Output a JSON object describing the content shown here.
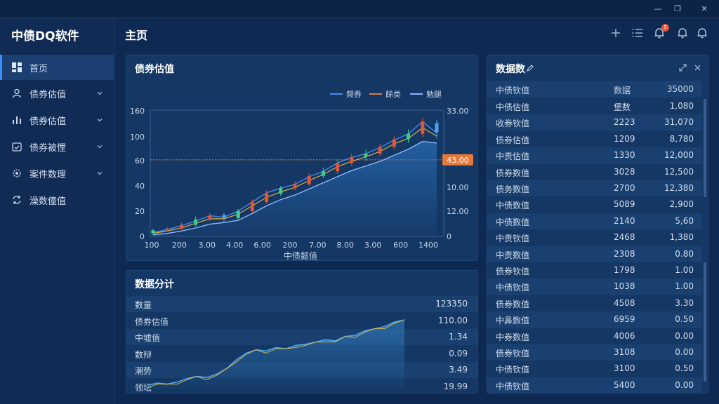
{
  "window": {
    "minimize": "—",
    "restore": "❐",
    "close": "✕"
  },
  "sidebar": {
    "brand": "中债DQ软件",
    "items": [
      {
        "label": "首页",
        "icon": "dashboard-icon",
        "active": true
      },
      {
        "label": "债券估值",
        "icon": "user-icon",
        "chevron": true
      },
      {
        "label": "债券估值",
        "icon": "bar-chart-icon",
        "chevron": true
      },
      {
        "label": "债券被悝",
        "icon": "calendar-icon",
        "chevron": true
      },
      {
        "label": "案件数理",
        "icon": "gear-icon",
        "chevron": true
      },
      {
        "label": "澡数僮值",
        "icon": "sync-icon",
        "chevron": false
      }
    ]
  },
  "header": {
    "title": "主页",
    "notification_count": "5"
  },
  "valuation_chart": {
    "title": "债券估值",
    "legend": [
      {
        "label": "频券",
        "color": "#4a8df0"
      },
      {
        "label": "餘类",
        "color": "#e07a3a"
      },
      {
        "label": "勉腿",
        "color": "#8fb6ff"
      }
    ],
    "price_tag": "43.00",
    "xlabel": "中债懿值"
  },
  "chart_data": {
    "type": "line",
    "title": "债券估值",
    "xlabel": "中债懿值",
    "x_tick_labels": [
      "100",
      "200",
      "3.00",
      "4.00",
      "6.00",
      "200",
      "7.00",
      "8.00",
      "3.00",
      "600",
      "1400"
    ],
    "y_left_tick_labels": [
      "0",
      "20",
      "40",
      "60",
      "100",
      "160"
    ],
    "y_right_tick_labels": [
      "0",
      "12.00",
      "10.00",
      "20.00",
      "33.00"
    ],
    "ylim": [
      0,
      165
    ],
    "reference_line": 100,
    "current_value_label": "43.00",
    "x": [
      0,
      1,
      2,
      3,
      4,
      5,
      6,
      7,
      8,
      9,
      10,
      11,
      12,
      13,
      14,
      15,
      16,
      17,
      18,
      19,
      20
    ],
    "series": [
      {
        "name": "频券",
        "values": [
          5,
          9,
          14,
          20,
          27,
          25,
          33,
          45,
          57,
          63,
          68,
          78,
          85,
          96,
          103,
          108,
          116,
          126,
          134,
          150,
          135
        ]
      },
      {
        "name": "餘类",
        "values": [
          4,
          7,
          11,
          17,
          23,
          23,
          29,
          40,
          51,
          58,
          64,
          73,
          81,
          91,
          98,
          104,
          111,
          121,
          128,
          142,
          131
        ]
      },
      {
        "name": "勉腿",
        "values": [
          2,
          4,
          7,
          11,
          16,
          18,
          21,
          30,
          40,
          48,
          54,
          62,
          70,
          78,
          86,
          92,
          98,
          106,
          114,
          124,
          122
        ]
      }
    ],
    "candles": [
      {
        "o": 4,
        "c": 8,
        "h": 10,
        "l": 2
      },
      {
        "o": 8,
        "c": 10,
        "h": 12,
        "l": 6
      },
      {
        "o": 10,
        "c": 15,
        "h": 18,
        "l": 9
      },
      {
        "o": 15,
        "c": 22,
        "h": 26,
        "l": 13
      },
      {
        "o": 22,
        "c": 27,
        "h": 30,
        "l": 20
      },
      {
        "o": 28,
        "c": 24,
        "h": 31,
        "l": 18
      },
      {
        "o": 24,
        "c": 33,
        "h": 36,
        "l": 22
      },
      {
        "o": 33,
        "c": 45,
        "h": 48,
        "l": 31
      },
      {
        "o": 45,
        "c": 56,
        "h": 60,
        "l": 43
      },
      {
        "o": 56,
        "c": 63,
        "h": 66,
        "l": 53
      },
      {
        "o": 63,
        "c": 68,
        "h": 72,
        "l": 60
      },
      {
        "o": 68,
        "c": 79,
        "h": 83,
        "l": 66
      },
      {
        "o": 79,
        "c": 85,
        "h": 90,
        "l": 76
      },
      {
        "o": 85,
        "c": 96,
        "h": 100,
        "l": 82
      },
      {
        "o": 96,
        "c": 104,
        "h": 108,
        "l": 92
      },
      {
        "o": 104,
        "c": 108,
        "h": 113,
        "l": 99
      },
      {
        "o": 108,
        "c": 117,
        "h": 121,
        "l": 105
      },
      {
        "o": 117,
        "c": 127,
        "h": 131,
        "l": 114
      },
      {
        "o": 127,
        "c": 134,
        "h": 140,
        "l": 122
      },
      {
        "o": 134,
        "c": 150,
        "h": 155,
        "l": 130
      },
      {
        "o": 148,
        "c": 136,
        "h": 152,
        "l": 128
      }
    ]
  },
  "stats": {
    "title": "数据分计",
    "rows": [
      {
        "label": "数量",
        "value": "123350"
      },
      {
        "label": "债券估值",
        "value": "110.00"
      },
      {
        "label": "中墟值",
        "value": "1.34"
      },
      {
        "label": "数辩",
        "value": "0.09"
      },
      {
        "label": "潮势",
        "value": "3.49"
      },
      {
        "label": "领坛",
        "value": "19.99"
      }
    ],
    "trend": [
      3,
      5,
      4,
      6,
      9,
      11,
      10,
      13,
      18,
      26,
      32,
      35,
      34,
      37,
      36,
      39,
      40,
      42,
      44,
      43,
      47,
      48,
      52,
      54,
      56,
      60,
      62
    ]
  },
  "data_table": {
    "title": "数据数",
    "header": {
      "c1": "中债钦值",
      "c2": "数据",
      "c3": "35000"
    },
    "rows": [
      {
        "c1": "中债估值",
        "c2": "堡数",
        "c3": "1,080"
      },
      {
        "c1": "收券钦值",
        "c2": "2223",
        "c3": "31,070"
      },
      {
        "c1": "债券估值",
        "c2": "1209",
        "c3": "8,780"
      },
      {
        "c1": "中责估值",
        "c2": "1330",
        "c3": "12,000"
      },
      {
        "c1": "债券数值",
        "c2": "3028",
        "c3": "12,500"
      },
      {
        "c1": "债务数值",
        "c2": "2700",
        "c3": "12,380"
      },
      {
        "c1": "中债数值",
        "c2": "5089",
        "c3": "2,900"
      },
      {
        "c1": "中债数值",
        "c2": "2140",
        "c3": "5,60"
      },
      {
        "c1": "中责钦值",
        "c2": "2468",
        "c3": "1,380"
      },
      {
        "c1": "中责数值",
        "c2": "2308",
        "c3": "0.80"
      },
      {
        "c1": "债券钦值",
        "c2": "1798",
        "c3": "1.00"
      },
      {
        "c1": "中债钦值",
        "c2": "1038",
        "c3": "1.00"
      },
      {
        "c1": "债券数值",
        "c2": "4508",
        "c3": "3.30"
      },
      {
        "c1": "中鼻数值",
        "c2": "6959",
        "c3": "0.50"
      },
      {
        "c1": "中券数值",
        "c2": "4006",
        "c3": "0.00"
      },
      {
        "c1": "债券钦值",
        "c2": "3108",
        "c3": "0.00"
      },
      {
        "c1": "中债钦值",
        "c2": "3100",
        "c3": "0.50"
      },
      {
        "c1": "中债钦值",
        "c2": "5400",
        "c3": "0.00"
      }
    ]
  }
}
